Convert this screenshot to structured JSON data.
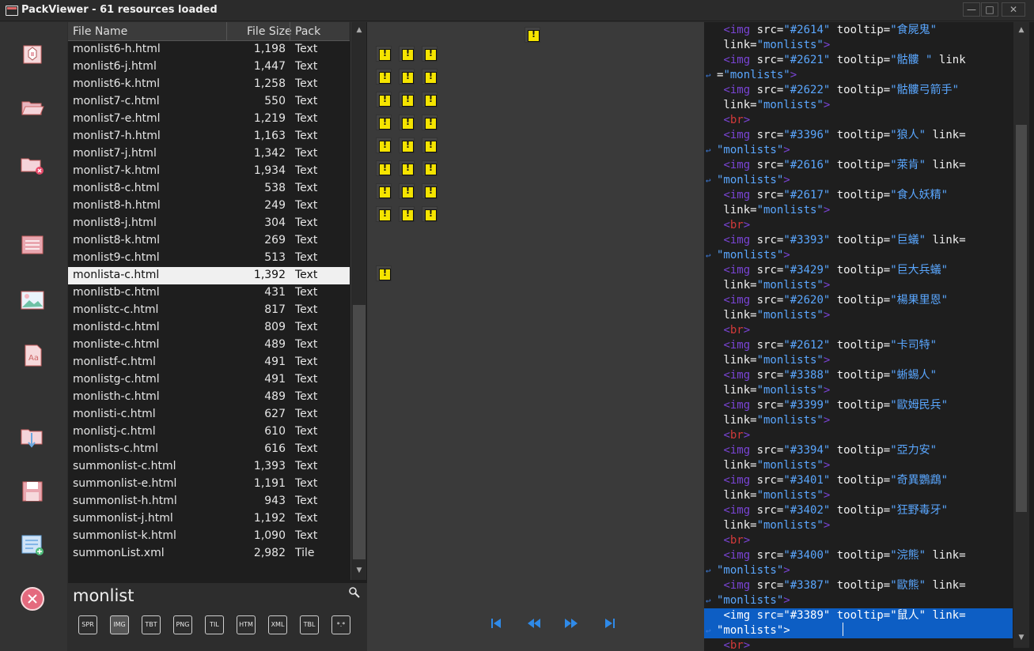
{
  "window": {
    "title": "PackViewer - 61 resources loaded"
  },
  "columns": {
    "name": "File Name",
    "size": "File Size",
    "pack": "Pack"
  },
  "files": [
    {
      "name": "monlist6-h.html",
      "size": "1,198",
      "pack": "Text"
    },
    {
      "name": "monlist6-j.html",
      "size": "1,447",
      "pack": "Text"
    },
    {
      "name": "monlist6-k.html",
      "size": "1,258",
      "pack": "Text"
    },
    {
      "name": "monlist7-c.html",
      "size": "550",
      "pack": "Text"
    },
    {
      "name": "monlist7-e.html",
      "size": "1,219",
      "pack": "Text"
    },
    {
      "name": "monlist7-h.html",
      "size": "1,163",
      "pack": "Text"
    },
    {
      "name": "monlist7-j.html",
      "size": "1,342",
      "pack": "Text"
    },
    {
      "name": "monlist7-k.html",
      "size": "1,934",
      "pack": "Text"
    },
    {
      "name": "monlist8-c.html",
      "size": "538",
      "pack": "Text"
    },
    {
      "name": "monlist8-h.html",
      "size": "249",
      "pack": "Text"
    },
    {
      "name": "monlist8-j.html",
      "size": "304",
      "pack": "Text"
    },
    {
      "name": "monlist8-k.html",
      "size": "269",
      "pack": "Text"
    },
    {
      "name": "monlist9-c.html",
      "size": "513",
      "pack": "Text"
    },
    {
      "name": "monlista-c.html",
      "size": "1,392",
      "pack": "Text",
      "selected": true
    },
    {
      "name": "monlistb-c.html",
      "size": "431",
      "pack": "Text"
    },
    {
      "name": "monlistc-c.html",
      "size": "817",
      "pack": "Text"
    },
    {
      "name": "monlistd-c.html",
      "size": "809",
      "pack": "Text"
    },
    {
      "name": "monliste-c.html",
      "size": "489",
      "pack": "Text"
    },
    {
      "name": "monlistf-c.html",
      "size": "491",
      "pack": "Text"
    },
    {
      "name": "monlistg-c.html",
      "size": "491",
      "pack": "Text"
    },
    {
      "name": "monlisth-c.html",
      "size": "489",
      "pack": "Text"
    },
    {
      "name": "monlisti-c.html",
      "size": "627",
      "pack": "Text"
    },
    {
      "name": "monlistj-c.html",
      "size": "610",
      "pack": "Text"
    },
    {
      "name": "monlists-c.html",
      "size": "616",
      "pack": "Text"
    },
    {
      "name": "summonlist-c.html",
      "size": "1,393",
      "pack": "Text"
    },
    {
      "name": "summonlist-e.html",
      "size": "1,191",
      "pack": "Text"
    },
    {
      "name": "summonlist-h.html",
      "size": "943",
      "pack": "Text"
    },
    {
      "name": "summonlist-j.html",
      "size": "1,192",
      "pack": "Text"
    },
    {
      "name": "summonlist-k.html",
      "size": "1,090",
      "pack": "Text"
    },
    {
      "name": "summonList.xml",
      "size": "2,982",
      "pack": "Tile"
    }
  ],
  "search": {
    "value": "monlist"
  },
  "filters": [
    {
      "label": "SPR",
      "active": false
    },
    {
      "label": "IMG",
      "active": true
    },
    {
      "label": "TBT",
      "active": false
    },
    {
      "label": "PNG",
      "active": false
    },
    {
      "label": "TIL",
      "active": false
    },
    {
      "label": "HTM",
      "active": false
    },
    {
      "label": "XML",
      "active": false
    },
    {
      "label": "TBL",
      "active": false
    },
    {
      "label": "*.*",
      "active": false
    }
  ],
  "toolbar_icons": [
    "package-icon",
    "open-folder-icon",
    "close-folder-icon",
    "list-icon",
    "image-icon",
    "font-icon",
    "export-folder-icon",
    "save-icon",
    "add-list-icon",
    "close-circle-icon"
  ],
  "nav_icons": [
    "first-icon",
    "previous-icon",
    "next-icon",
    "last-icon"
  ],
  "code_lines": [
    [
      [
        "t-attr",
        " "
      ],
      [
        "t-tag",
        "<img"
      ],
      [
        "t-attr",
        " src="
      ],
      [
        "t-val",
        "\"#2614\""
      ],
      [
        "t-attr",
        " tooltip="
      ],
      [
        "t-val",
        "\"食屍鬼\""
      ]
    ],
    [
      [
        "t-attr",
        " link="
      ],
      [
        "t-val",
        "\"monlists\""
      ],
      [
        "t-tag",
        ">"
      ]
    ],
    [
      [
        "t-attr",
        " "
      ],
      [
        "t-tag",
        "<img"
      ],
      [
        "t-attr",
        " src="
      ],
      [
        "t-val",
        "\"#2621\""
      ],
      [
        "t-attr",
        " tooltip="
      ],
      [
        "t-val",
        "\"骷髏 \""
      ],
      [
        "t-attr",
        " link"
      ]
    ],
    [
      [
        "t-attr",
        "="
      ],
      [
        "t-val",
        "\"monlists\""
      ],
      [
        "t-tag",
        ">"
      ]
    ],
    [
      [
        "t-attr",
        " "
      ],
      [
        "t-tag",
        "<img"
      ],
      [
        "t-attr",
        " src="
      ],
      [
        "t-val",
        "\"#2622\""
      ],
      [
        "t-attr",
        " tooltip="
      ],
      [
        "t-val",
        "\"骷髏弓箭手\""
      ]
    ],
    [
      [
        "t-attr",
        " link="
      ],
      [
        "t-val",
        "\"monlists\""
      ],
      [
        "t-tag",
        ">"
      ]
    ],
    [
      [
        "t-attr",
        " "
      ],
      [
        "t-tag",
        "<"
      ],
      [
        "t-red",
        "br"
      ],
      [
        "t-tag",
        ">"
      ]
    ],
    [
      [
        "t-attr",
        " "
      ],
      [
        "t-tag",
        "<img"
      ],
      [
        "t-attr",
        " src="
      ],
      [
        "t-val",
        "\"#3396\""
      ],
      [
        "t-attr",
        " tooltip="
      ],
      [
        "t-val",
        "\"狼人\""
      ],
      [
        "t-attr",
        " link="
      ]
    ],
    [
      [
        "t-val",
        "\"monlists\""
      ],
      [
        "t-tag",
        ">"
      ]
    ],
    [
      [
        "t-attr",
        " "
      ],
      [
        "t-tag",
        "<img"
      ],
      [
        "t-attr",
        " src="
      ],
      [
        "t-val",
        "\"#2616\""
      ],
      [
        "t-attr",
        " tooltip="
      ],
      [
        "t-val",
        "\"萊肯\""
      ],
      [
        "t-attr",
        " link="
      ]
    ],
    [
      [
        "t-val",
        "\"monlists\""
      ],
      [
        "t-tag",
        ">"
      ]
    ],
    [
      [
        "t-attr",
        " "
      ],
      [
        "t-tag",
        "<img"
      ],
      [
        "t-attr",
        " src="
      ],
      [
        "t-val",
        "\"#2617\""
      ],
      [
        "t-attr",
        " tooltip="
      ],
      [
        "t-val",
        "\"食人妖精\""
      ]
    ],
    [
      [
        "t-attr",
        " link="
      ],
      [
        "t-val",
        "\"monlists\""
      ],
      [
        "t-tag",
        ">"
      ]
    ],
    [
      [
        "t-attr",
        " "
      ],
      [
        "t-tag",
        "<"
      ],
      [
        "t-red",
        "br"
      ],
      [
        "t-tag",
        ">"
      ]
    ],
    [
      [
        "t-attr",
        " "
      ],
      [
        "t-tag",
        "<img"
      ],
      [
        "t-attr",
        " src="
      ],
      [
        "t-val",
        "\"#3393\""
      ],
      [
        "t-attr",
        " tooltip="
      ],
      [
        "t-val",
        "\"巨蟻\""
      ],
      [
        "t-attr",
        " link="
      ]
    ],
    [
      [
        "t-val",
        "\"monlists\""
      ],
      [
        "t-tag",
        ">"
      ]
    ],
    [
      [
        "t-attr",
        " "
      ],
      [
        "t-tag",
        "<img"
      ],
      [
        "t-attr",
        " src="
      ],
      [
        "t-val",
        "\"#3429\""
      ],
      [
        "t-attr",
        " tooltip="
      ],
      [
        "t-val",
        "\"巨大兵蟻\""
      ]
    ],
    [
      [
        "t-attr",
        " link="
      ],
      [
        "t-val",
        "\"monlists\""
      ],
      [
        "t-tag",
        ">"
      ]
    ],
    [
      [
        "t-attr",
        " "
      ],
      [
        "t-tag",
        "<img"
      ],
      [
        "t-attr",
        " src="
      ],
      [
        "t-val",
        "\"#2620\""
      ],
      [
        "t-attr",
        " tooltip="
      ],
      [
        "t-val",
        "\"楊果里恩\""
      ]
    ],
    [
      [
        "t-attr",
        " link="
      ],
      [
        "t-val",
        "\"monlists\""
      ],
      [
        "t-tag",
        ">"
      ]
    ],
    [
      [
        "t-attr",
        " "
      ],
      [
        "t-tag",
        "<"
      ],
      [
        "t-red",
        "br"
      ],
      [
        "t-tag",
        ">"
      ]
    ],
    [
      [
        "t-attr",
        " "
      ],
      [
        "t-tag",
        "<img"
      ],
      [
        "t-attr",
        " src="
      ],
      [
        "t-val",
        "\"#2612\""
      ],
      [
        "t-attr",
        " tooltip="
      ],
      [
        "t-val",
        "\"卡司特\""
      ]
    ],
    [
      [
        "t-attr",
        " link="
      ],
      [
        "t-val",
        "\"monlists\""
      ],
      [
        "t-tag",
        ">"
      ]
    ],
    [
      [
        "t-attr",
        " "
      ],
      [
        "t-tag",
        "<img"
      ],
      [
        "t-attr",
        " src="
      ],
      [
        "t-val",
        "\"#3388\""
      ],
      [
        "t-attr",
        " tooltip="
      ],
      [
        "t-val",
        "\"蜥蜴人\""
      ]
    ],
    [
      [
        "t-attr",
        " link="
      ],
      [
        "t-val",
        "\"monlists\""
      ],
      [
        "t-tag",
        ">"
      ]
    ],
    [
      [
        "t-attr",
        " "
      ],
      [
        "t-tag",
        "<img"
      ],
      [
        "t-attr",
        " src="
      ],
      [
        "t-val",
        "\"#3399\""
      ],
      [
        "t-attr",
        " tooltip="
      ],
      [
        "t-val",
        "\"歐姆民兵\""
      ]
    ],
    [
      [
        "t-attr",
        " link="
      ],
      [
        "t-val",
        "\"monlists\""
      ],
      [
        "t-tag",
        ">"
      ]
    ],
    [
      [
        "t-attr",
        " "
      ],
      [
        "t-tag",
        "<"
      ],
      [
        "t-red",
        "br"
      ],
      [
        "t-tag",
        ">"
      ]
    ],
    [
      [
        "t-attr",
        " "
      ],
      [
        "t-tag",
        "<img"
      ],
      [
        "t-attr",
        " src="
      ],
      [
        "t-val",
        "\"#3394\""
      ],
      [
        "t-attr",
        " tooltip="
      ],
      [
        "t-val",
        "\"亞力安\""
      ]
    ],
    [
      [
        "t-attr",
        " link="
      ],
      [
        "t-val",
        "\"monlists\""
      ],
      [
        "t-tag",
        ">"
      ]
    ],
    [
      [
        "t-attr",
        " "
      ],
      [
        "t-tag",
        "<img"
      ],
      [
        "t-attr",
        " src="
      ],
      [
        "t-val",
        "\"#3401\""
      ],
      [
        "t-attr",
        " tooltip="
      ],
      [
        "t-val",
        "\"奇異鸚鵡\""
      ]
    ],
    [
      [
        "t-attr",
        " link="
      ],
      [
        "t-val",
        "\"monlists\""
      ],
      [
        "t-tag",
        ">"
      ]
    ],
    [
      [
        "t-attr",
        " "
      ],
      [
        "t-tag",
        "<img"
      ],
      [
        "t-attr",
        " src="
      ],
      [
        "t-val",
        "\"#3402\""
      ],
      [
        "t-attr",
        " tooltip="
      ],
      [
        "t-val",
        "\"狂野毒牙\""
      ]
    ],
    [
      [
        "t-attr",
        " link="
      ],
      [
        "t-val",
        "\"monlists\""
      ],
      [
        "t-tag",
        ">"
      ]
    ],
    [
      [
        "t-attr",
        " "
      ],
      [
        "t-tag",
        "<"
      ],
      [
        "t-red",
        "br"
      ],
      [
        "t-tag",
        ">"
      ]
    ],
    [
      [
        "t-attr",
        " "
      ],
      [
        "t-tag",
        "<img"
      ],
      [
        "t-attr",
        " src="
      ],
      [
        "t-val",
        "\"#3400\""
      ],
      [
        "t-attr",
        " tooltip="
      ],
      [
        "t-val",
        "\"浣熊\""
      ],
      [
        "t-attr",
        " link="
      ]
    ],
    [
      [
        "t-val",
        "\"monlists\""
      ],
      [
        "t-tag",
        ">"
      ]
    ],
    [
      [
        "t-attr",
        " "
      ],
      [
        "t-tag",
        "<img"
      ],
      [
        "t-attr",
        " src="
      ],
      [
        "t-val",
        "\"#3387\""
      ],
      [
        "t-attr",
        " tooltip="
      ],
      [
        "t-val",
        "\"歐熊\""
      ],
      [
        "t-attr",
        " link="
      ]
    ],
    [
      [
        "t-val",
        "\"monlists\""
      ],
      [
        "t-tag",
        ">"
      ]
    ],
    [
      [
        "t-attr",
        " "
      ],
      [
        "t-tag",
        "<img"
      ],
      [
        "t-attr",
        " src="
      ],
      [
        "t-val",
        "\"#3389\""
      ],
      [
        "t-attr",
        " tooltip="
      ],
      [
        "t-val",
        "\"鼠人\""
      ],
      [
        "t-attr",
        " link="
      ]
    ],
    [
      [
        "t-val",
        "\"monlists\""
      ],
      [
        "t-tag",
        ">"
      ]
    ],
    [
      [
        "t-attr",
        " "
      ],
      [
        "t-tag",
        "<"
      ],
      [
        "t-red",
        "br"
      ],
      [
        "t-tag",
        ">"
      ]
    ]
  ],
  "code_highlight_lines": [
    39,
    40
  ],
  "code_wrap_lines": [
    3,
    8,
    10,
    15,
    36,
    38,
    40
  ],
  "colors": {
    "selection": "#0d5ec4",
    "tag": "#7a44d6",
    "value": "#5aa7ff",
    "br": "#d23a3a"
  }
}
